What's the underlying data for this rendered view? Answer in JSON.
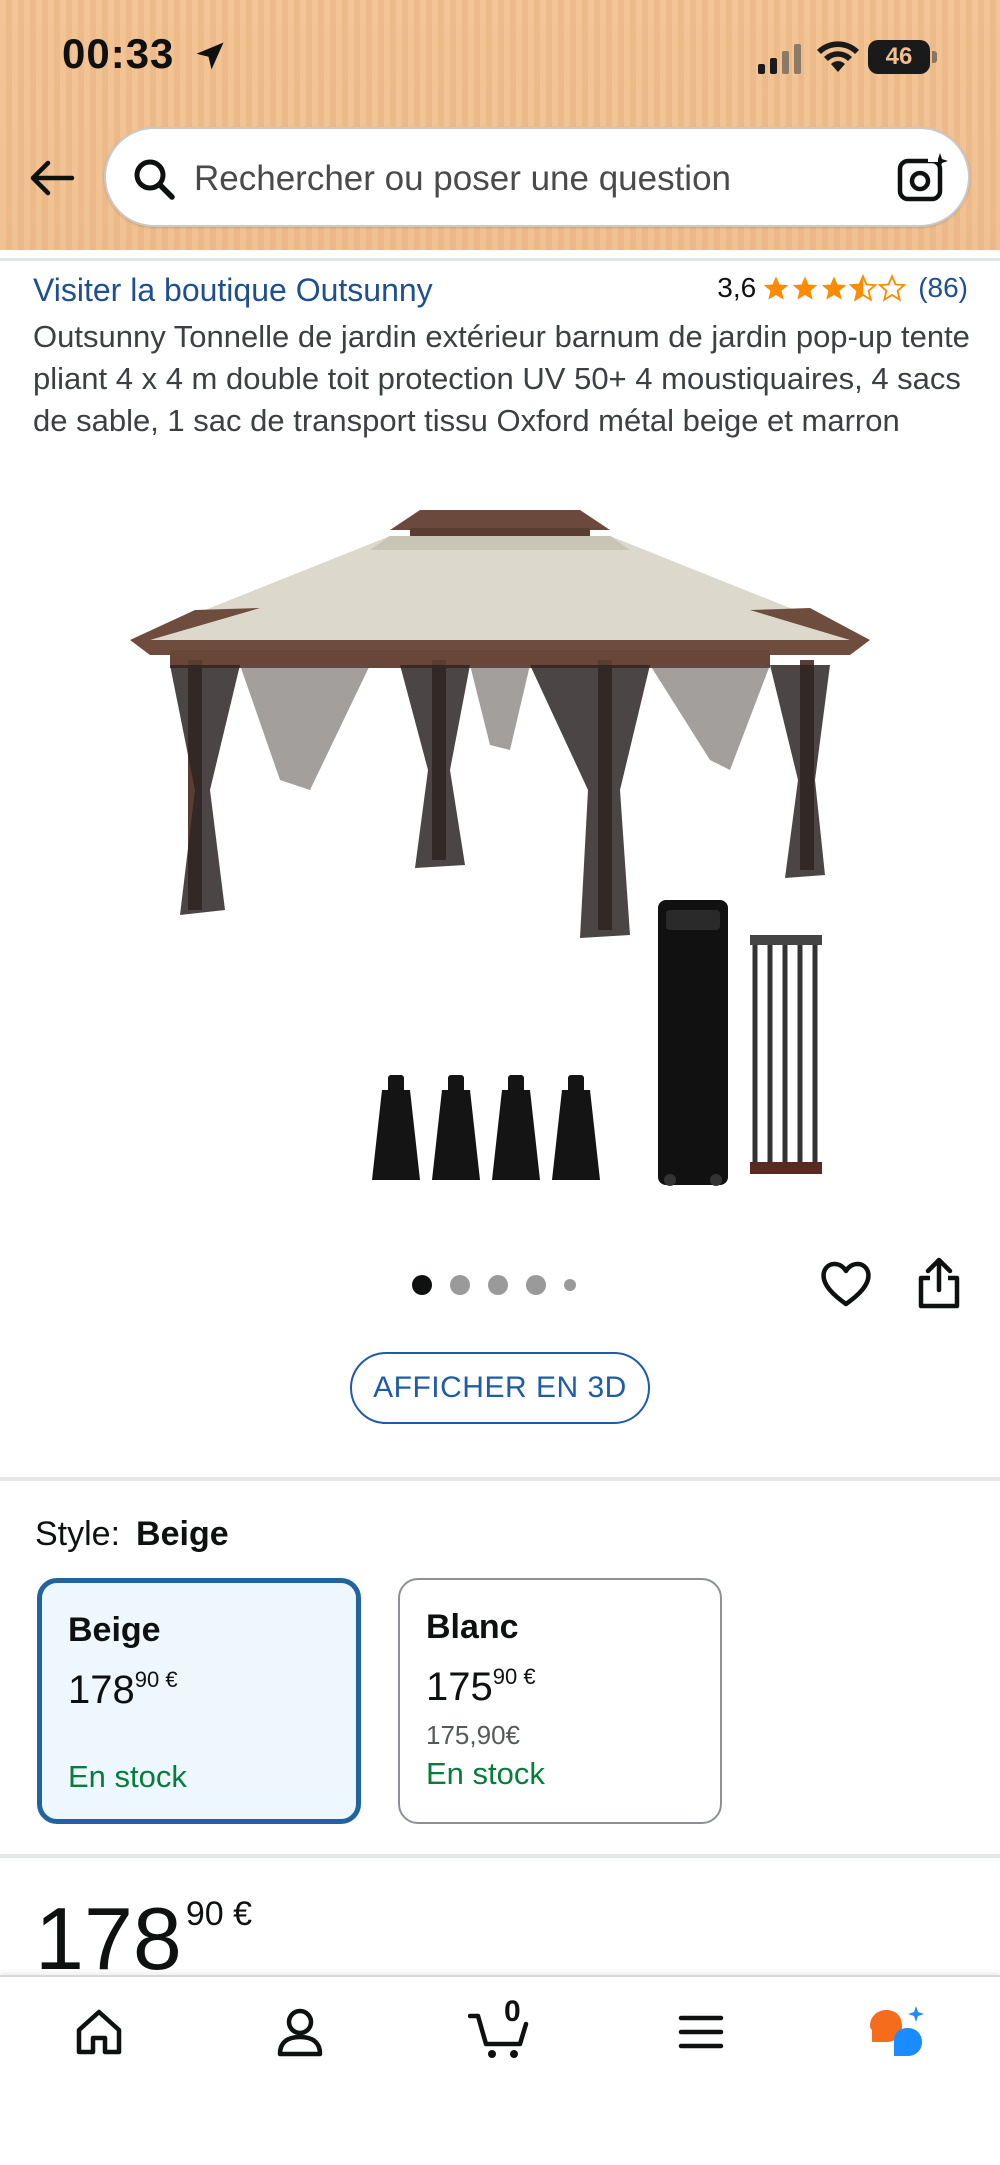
{
  "status_bar": {
    "time": "00:33",
    "battery": "46"
  },
  "header": {
    "search_placeholder": "Rechercher ou poser une question"
  },
  "product": {
    "store_link": "Visiter la boutique Outsunny",
    "rating_value": "3,6",
    "stars": 3.5,
    "review_count": "(86)",
    "title": "Outsunny Tonnelle de jardin extérieur barnum de jardin pop-up tente pliant 4 x 4 m double toit protection UV 50+ 4 moustiquaires, 4 sacs de sable, 1 sac de transport tissu Oxford métal beige et marron",
    "image_pages": 5,
    "image_active_index": 0,
    "view_3d_label": "AFFICHER EN 3D"
  },
  "style_selector": {
    "label": "Style:",
    "selected_value": "Beige",
    "options": [
      {
        "name": "Beige",
        "price_whole": "178",
        "price_fraction": "90 €",
        "old_price": "",
        "stock": "En stock"
      },
      {
        "name": "Blanc",
        "price_whole": "175",
        "price_fraction": "90 €",
        "old_price": "175,90€",
        "stock": "En stock"
      }
    ]
  },
  "price": {
    "whole": "178",
    "fraction": "90 €"
  },
  "bottom_nav": {
    "cart_count": "0",
    "items": [
      "home-icon",
      "account-icon",
      "cart-icon",
      "menu-icon",
      "rufus-icon"
    ]
  },
  "colors": {
    "header_bg": "#f2bf8c",
    "link_blue": "#1d4f91",
    "star_orange": "#ff8c00",
    "stock_green": "#067d3a",
    "selected_border": "#2162a1"
  }
}
